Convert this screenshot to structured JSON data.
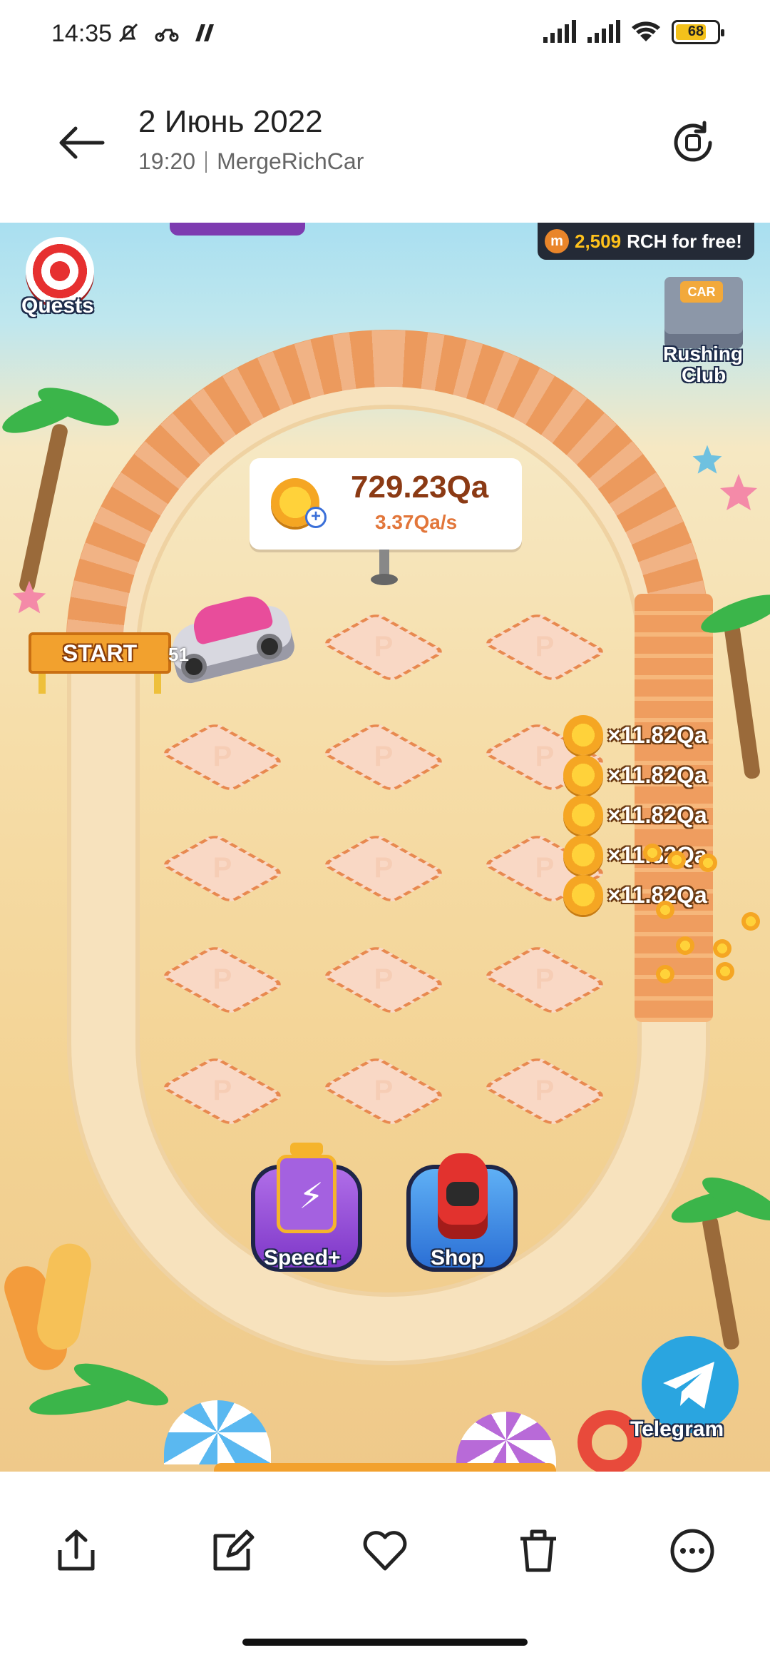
{
  "status_bar": {
    "time": "14:35",
    "battery_level": 68,
    "battery_text": "68"
  },
  "header": {
    "title": "2 Июнь 2022",
    "time": "19:20",
    "source": "MergeRichCar"
  },
  "game": {
    "quests_label": "Quests",
    "rch_banner": {
      "amount": "2,509",
      "text": "RCH for free!",
      "coin_letter": "m"
    },
    "rushing_club": {
      "sign": "CAR",
      "label_line1": "Rushing",
      "label_line2": "Club"
    },
    "coins": {
      "total": "729.23Qa",
      "rate": "3.37Qa/s"
    },
    "start_label": "START",
    "car_number": "51",
    "pad_letter": "P",
    "earnings": [
      "×11.82Qa",
      "×11.82Qa",
      "×11.82Qa",
      "×11.82Qa",
      "×11.82Qa"
    ],
    "speed_label": "Speed+",
    "shop_label": "Shop",
    "telegram_label": "Telegram"
  },
  "toolbar": {
    "items": [
      "share-icon",
      "edit-icon",
      "heart-icon",
      "trash-icon",
      "more-icon"
    ]
  },
  "colors": {
    "accent_orange": "#ec9a5d",
    "battery_yellow": "#f3c11b",
    "telegram_blue": "#2aa5e0",
    "rch_yellow": "#ffc21c"
  }
}
